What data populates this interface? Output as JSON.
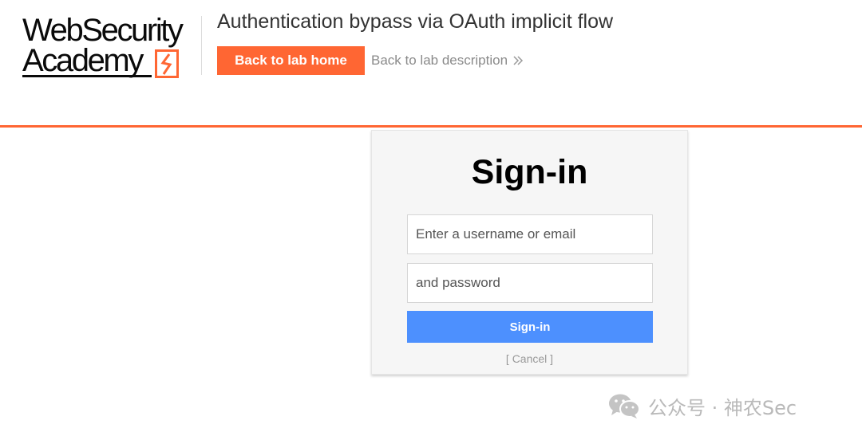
{
  "header": {
    "logo_line1": "WebSecurity",
    "logo_line2": "Academy",
    "lab_title": "Authentication bypass via OAuth implicit flow",
    "back_home_label": "Back to lab home",
    "back_description_label": "Back to lab description",
    "accent_color": "#ff6633"
  },
  "signin": {
    "title": "Sign-in",
    "username_placeholder": "Enter a username or email",
    "password_placeholder": "and password",
    "submit_label": "Sign-in",
    "cancel_label": "[ Cancel ]",
    "button_color": "#4d90fe"
  },
  "watermark": {
    "icon": "wechat-icon",
    "text": "公众号 · 神农Sec"
  }
}
